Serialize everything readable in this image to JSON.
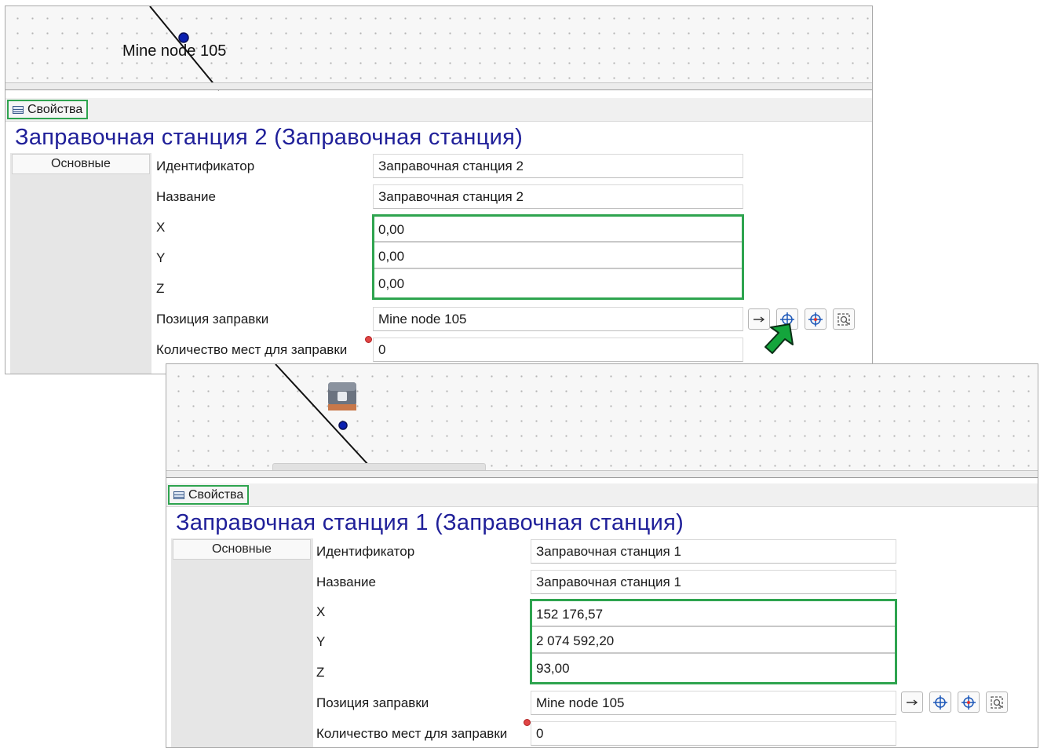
{
  "panels": [
    {
      "node_label": "Mine node 105",
      "tab_label": "Свойства",
      "title": "Заправочная станция 2 (Заправочная станция)",
      "category": "Основные",
      "labels": {
        "id": "Идентификатор",
        "name": "Название",
        "x": "X",
        "y": "Y",
        "z": "Z",
        "position": "Позиция заправки",
        "places": "Количество мест для заправки"
      },
      "values": {
        "id": "Заправочная станция 2",
        "name": "Заправочная станция 2",
        "x": "0,00",
        "y": "0,00",
        "z": "0,00",
        "position": "Mine node 105",
        "places": "0"
      }
    },
    {
      "tab_label": "Свойства",
      "title": "Заправочная станция 1 (Заправочная станция)",
      "category": "Основные",
      "labels": {
        "id": "Идентификатор",
        "name": "Название",
        "x": "X",
        "y": "Y",
        "z": "Z",
        "position": "Позиция заправки",
        "places": "Количество мест для заправки"
      },
      "values": {
        "id": "Заправочная станция 1",
        "name": "Заправочная станция 1",
        "x": "152 176,57",
        "y": "2 074 592,20",
        "z": "93,00",
        "position": "Mine node 105",
        "places": "0"
      }
    }
  ],
  "colors": {
    "highlight": "#2ea44f",
    "title": "#1f1f99",
    "node": "#0a1fb0",
    "arrow": "#14a53c"
  },
  "icons": [
    "table-icon",
    "arrow-right-icon",
    "crosshair-icon",
    "target-icon",
    "zoom-extent-icon",
    "fuel-station-icon",
    "required-marker-icon"
  ]
}
